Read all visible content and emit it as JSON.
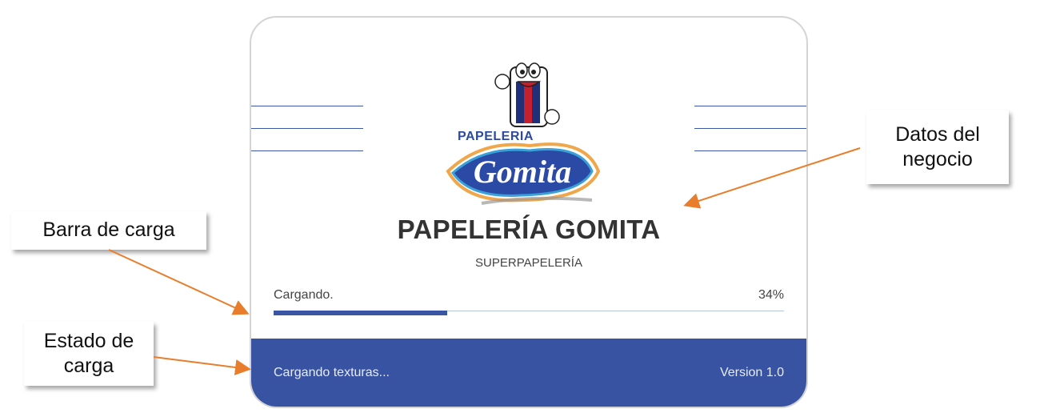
{
  "splash": {
    "logo_text_top": "PAPELERIA",
    "logo_text_main": "Gomita",
    "business_name": "PAPELERÍA GOMITA",
    "business_subtitle": "SUPERPAPELERÍA",
    "status_label": "Cargando.",
    "progress_text": "34%",
    "progress": 0.34,
    "footer_status": "Cargando texturas...",
    "version": "Version 1.0"
  },
  "callouts": {
    "business_data": "Datos del negocio",
    "loading_bar": "Barra de carga",
    "loading_state": "Estado de carga"
  },
  "colors": {
    "accent": "#3953a3",
    "arrow": "#e87e2c",
    "border": "#d4d4d4"
  }
}
